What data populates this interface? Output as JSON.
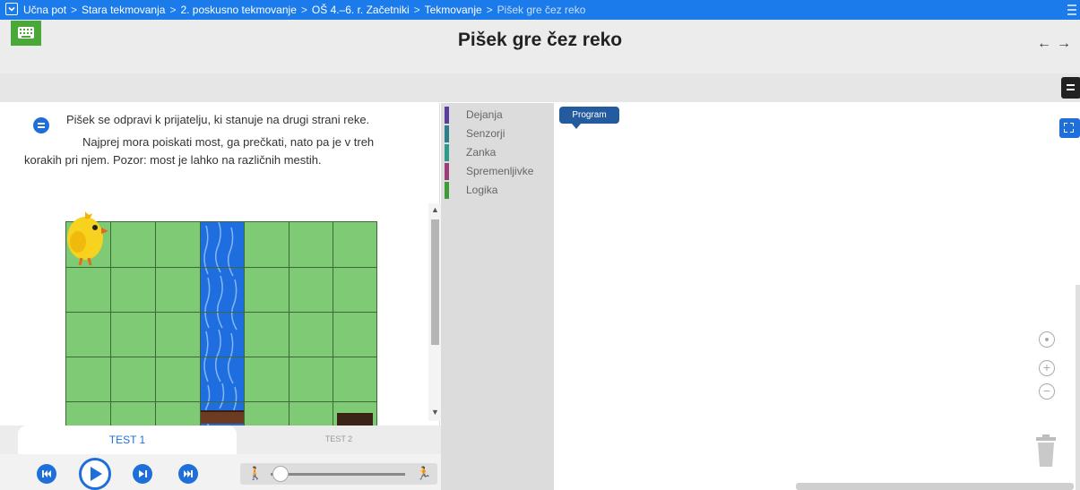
{
  "breadcrumb": {
    "items": [
      "Učna pot",
      "Stara tekmovanja",
      "2. poskusno tekmovanje",
      "OŠ 4.–6. r. Začetniki",
      "Tekmovanje",
      "Pišek gre čez reko"
    ],
    "separator": ">"
  },
  "header": {
    "title": "Pišek gre čez reko",
    "back_arrow": "←",
    "forward_arrow": "→"
  },
  "task": {
    "line1": "Pišek se odpravi k prijatelju, ki stanuje na drugi strani reke.",
    "line2": "Najprej mora poiskati most, ga prečkati, nato pa je v treh",
    "line3": "korakih pri njem. Pozor: most je lahko na različnih mestih."
  },
  "tests": {
    "tab1": "TEST 1",
    "tab2": "TEST 2",
    "active": "TEST 1"
  },
  "controls": {
    "speed_level": 0.05
  },
  "toolbox": {
    "categories": [
      {
        "label": "Dejanja",
        "color": "#5b3e9c"
      },
      {
        "label": "Senzorji",
        "color": "#2e7d8c"
      },
      {
        "label": "Zanka",
        "color": "#2e9a8a"
      },
      {
        "label": "Spremenljivke",
        "color": "#9a3d7a"
      },
      {
        "label": "Logika",
        "color": "#3f9a3a"
      }
    ]
  },
  "workspace": {
    "program_label": "Program"
  },
  "colors": {
    "accent": "#1c7bea",
    "grass": "#7fca74",
    "river": "#1f6ee0",
    "bridge": "#6d3b22",
    "keyboard_button": "#4aa838"
  },
  "icons": {
    "top_left": "chevron-down-icon",
    "keyboard": "keyboard-icon",
    "menu": "hamburger-icon",
    "fullscreen": "fullscreen-icon",
    "recenter": "recenter-icon",
    "zoom_in": "zoom-in-icon",
    "zoom_out": "zoom-out-icon",
    "trash": "trash-icon",
    "speed_slow": "walking-person-icon",
    "speed_fast": "running-person-icon"
  }
}
